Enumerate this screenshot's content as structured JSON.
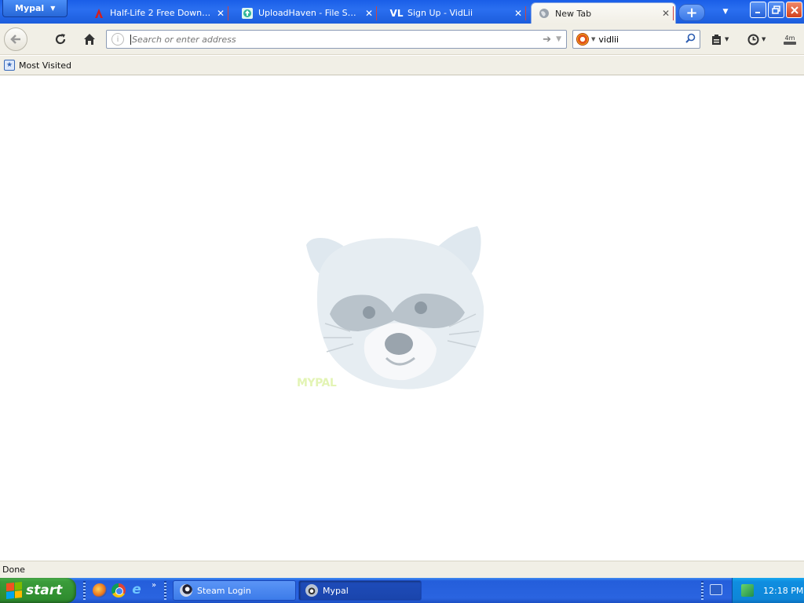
{
  "browser": {
    "app_menu": "Mypal",
    "tabs": [
      {
        "label": "Half-Life 2 Free Downloa...",
        "icon": "half-life-lambda-icon",
        "active": false
      },
      {
        "label": "UploadHaven - File Shari...",
        "icon": "uploadhaven-icon",
        "active": false
      },
      {
        "label": "Sign Up - VidLii",
        "icon": "vidlii-icon",
        "active": false
      },
      {
        "label": "New Tab",
        "icon": "globe-icon",
        "active": true
      }
    ],
    "tab_close_glyph": "✕",
    "new_tab_glyph": "+",
    "vidlii_logo": "VL"
  },
  "navbar": {
    "url_placeholder": "Search or enter address",
    "url_value": "",
    "search_value": "vidlii"
  },
  "bookmarks": {
    "items": [
      {
        "label": "Most Visited"
      }
    ]
  },
  "content": {
    "watermark_text": "MYPAL"
  },
  "status": {
    "text": "Done"
  },
  "taskbar": {
    "start_label": "start",
    "tasks": [
      {
        "label": "Steam Login",
        "icon": "steam-icon",
        "active": false
      },
      {
        "label": "Mypal",
        "icon": "mypal-raccoon-icon",
        "active": true
      }
    ],
    "clock": "12:18 PM"
  },
  "colors": {
    "titlebar_blue": "#2a6ff0",
    "toolbar_beige": "#f1efe6",
    "taskbar_blue": "#245edb",
    "start_green": "#3a9c3a",
    "tray_blue": "#0f8ee0"
  }
}
